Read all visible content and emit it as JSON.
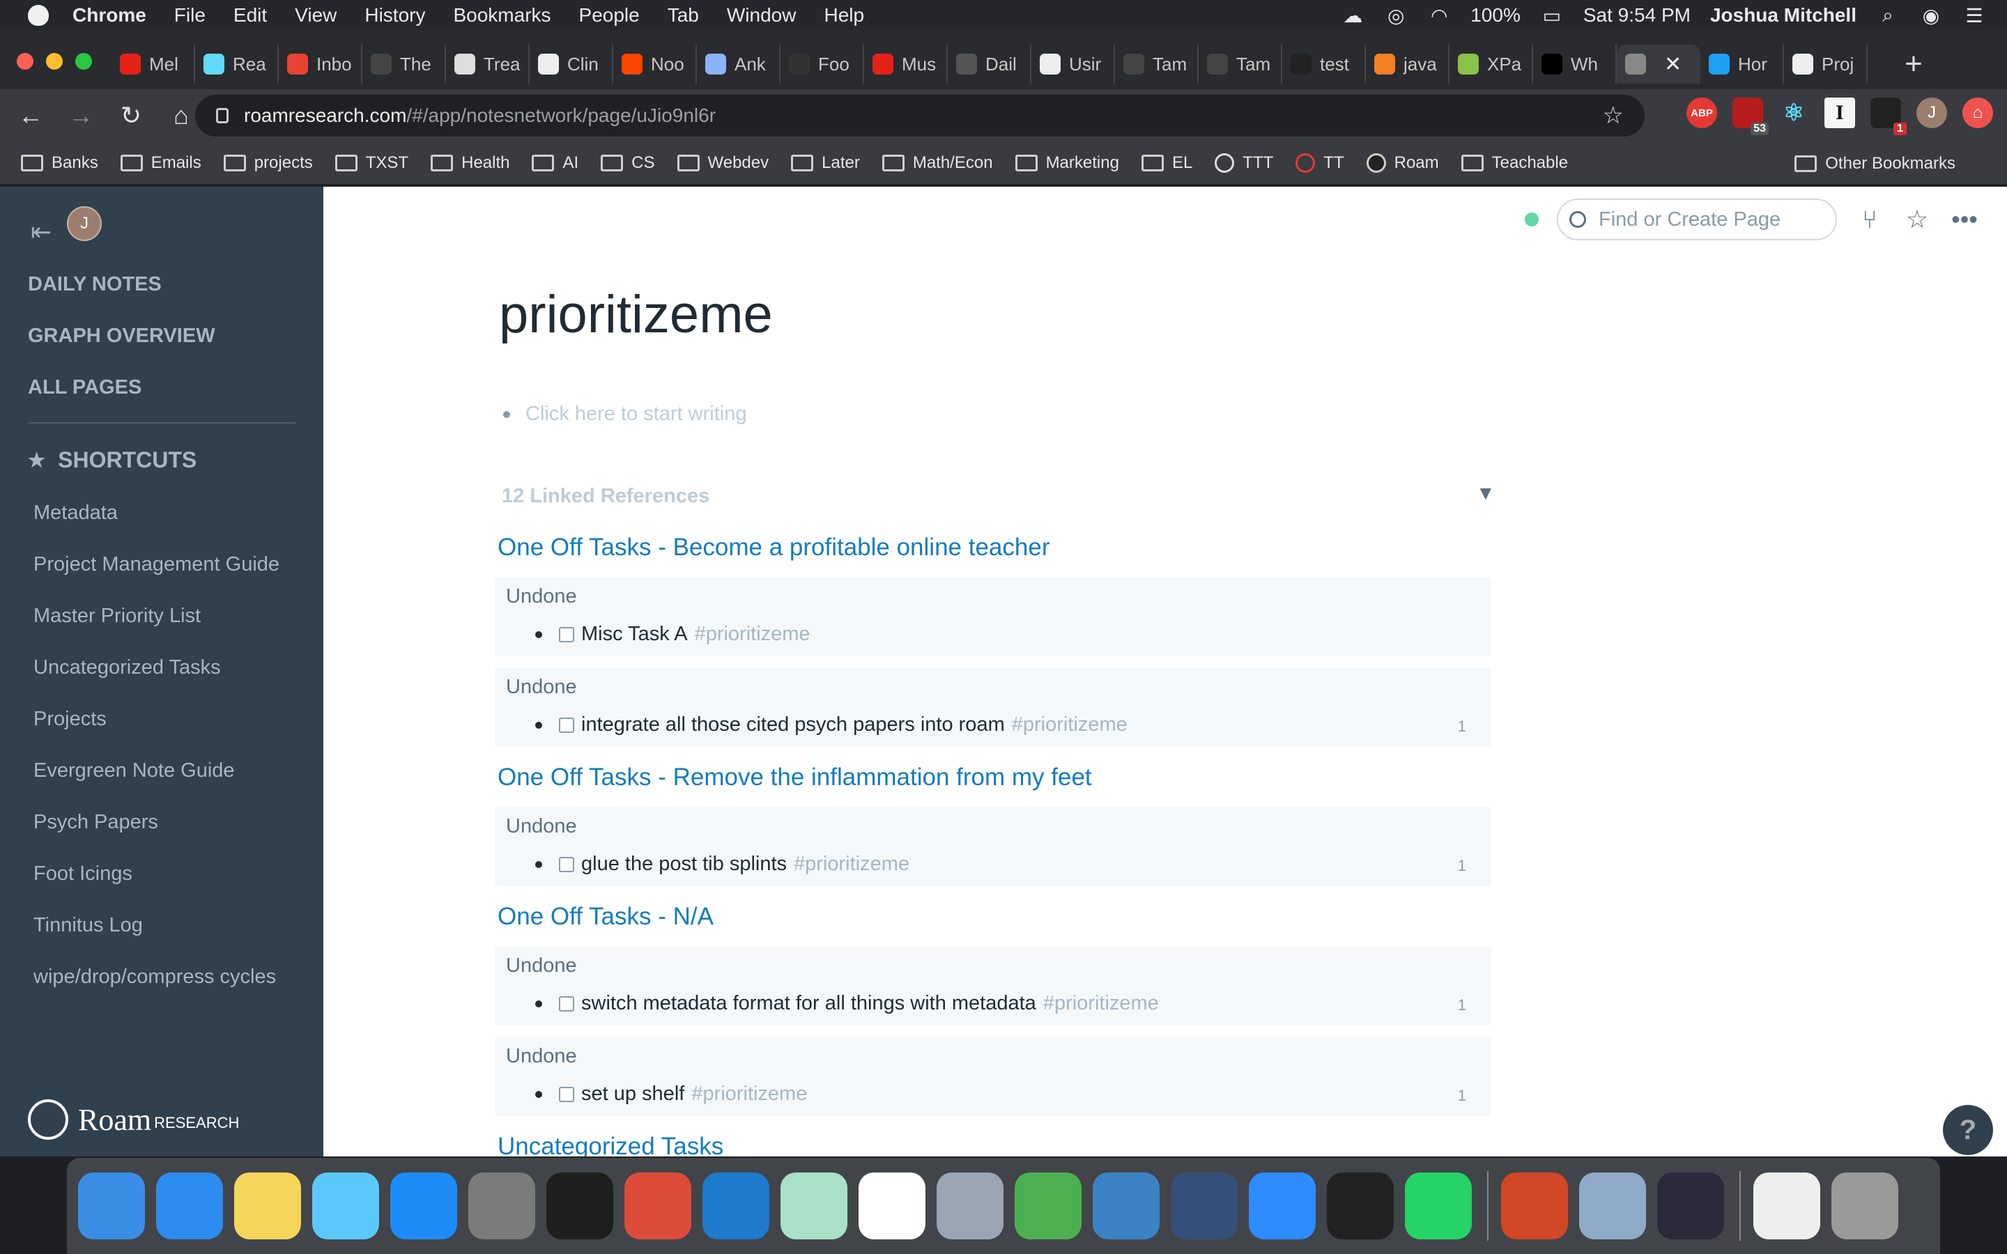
{
  "menubar": {
    "items": [
      "Chrome",
      "File",
      "Edit",
      "View",
      "History",
      "Bookmarks",
      "People",
      "Tab",
      "Window",
      "Help"
    ],
    "battery": "100%",
    "datetime": "Sat 9:54 PM",
    "user": "Joshua Mitchell"
  },
  "tabs": [
    {
      "label": "Mel",
      "color": "#e62117"
    },
    {
      "label": "Rea",
      "color": "#61dafb"
    },
    {
      "label": "Inbo",
      "color": "#ea4335"
    },
    {
      "label": "The",
      "color": "#444444"
    },
    {
      "label": "Trea",
      "color": "#dddddd"
    },
    {
      "label": "Clin",
      "color": "#eeeeee"
    },
    {
      "label": "Noo",
      "color": "#ff4500"
    },
    {
      "label": "Ank",
      "color": "#8ab4f8"
    },
    {
      "label": "Foo",
      "color": "#333333"
    },
    {
      "label": "Mus",
      "color": "#e62117"
    },
    {
      "label": "Dail",
      "color": "#555555"
    },
    {
      "label": "Usir",
      "color": "#eeeeee"
    },
    {
      "label": "Tam",
      "color": "#444444"
    },
    {
      "label": "Tam",
      "color": "#444444"
    },
    {
      "label": "test",
      "color": "#222222"
    },
    {
      "label": "java",
      "color": "#f48024"
    },
    {
      "label": "XPa",
      "color": "#8bc34a"
    },
    {
      "label": "Wh",
      "color": "#000000"
    },
    {
      "label": "",
      "color": "#888888",
      "active": true
    },
    {
      "label": "Hor",
      "color": "#1da1f2"
    },
    {
      "label": "Proj",
      "color": "#eeeeee"
    }
  ],
  "address": {
    "host": "roamresearch.com",
    "path": "/#/app/notesnetwork/page/uJio9nl6r"
  },
  "extensions": {
    "abp": "ABP",
    "ud_badge": "53",
    "ublock_badge": "1",
    "profile_initial": "J"
  },
  "bookmarks": [
    "Banks",
    "Emails",
    "projects",
    "TXST",
    "Health",
    "AI",
    "CS",
    "Webdev",
    "Later",
    "Math/Econ",
    "Marketing",
    "EL",
    "TTT",
    "TT",
    "Roam",
    "Teachable"
  ],
  "bookmarks_other": "Other Bookmarks",
  "sidebar": {
    "avatar_initial": "J",
    "daily_notes": "DAILY NOTES",
    "graph_overview": "GRAPH OVERVIEW",
    "all_pages": "ALL PAGES",
    "shortcuts_title": "SHORTCUTS",
    "shortcuts": [
      "Metadata",
      "Project Management Guide",
      "Master Priority List",
      "Uncategorized Tasks",
      "Projects",
      "Evergreen Note Guide",
      "Psych Papers",
      "Foot Icings",
      "Tinnitus Log",
      "wipe/drop/compress cycles"
    ],
    "logo_word": "Roam",
    "logo_sub": "RESEARCH"
  },
  "search": {
    "placeholder": "Find or Create Page"
  },
  "page": {
    "title": "prioritizeme",
    "empty_block": "Click here to start writing",
    "linked_refs_label": "12 Linked References"
  },
  "references": [
    {
      "title": "One Off Tasks - Become a profitable online teacher",
      "blocks": [
        {
          "group": "Undone",
          "text": "Misc Task A",
          "tag": "#prioritizeme",
          "count": ""
        },
        {
          "group": "Undone",
          "text": "integrate all those cited psych papers into roam",
          "tag": "#prioritizeme",
          "count": "1"
        }
      ]
    },
    {
      "title": "One Off Tasks - Remove the inflammation from my feet",
      "blocks": [
        {
          "group": "Undone",
          "text": "glue the post tib splints",
          "tag": "#prioritizeme",
          "count": "1"
        }
      ]
    },
    {
      "title": "One Off Tasks - N/A",
      "blocks": [
        {
          "group": "Undone",
          "text": "switch metadata format for all things with metadata",
          "tag": "#prioritizeme",
          "count": "1"
        },
        {
          "group": "Undone",
          "text": "set up shelf",
          "tag": "#prioritizeme",
          "count": "1"
        }
      ]
    },
    {
      "title": "Uncategorized Tasks",
      "blocks": []
    }
  ],
  "help_button": "?",
  "dock": [
    {
      "name": "finder",
      "color": "#3a8ee6"
    },
    {
      "name": "safari",
      "color": "#2c8cf0"
    },
    {
      "name": "notes",
      "color": "#f6d65a"
    },
    {
      "name": "messages",
      "color": "#5ac8fa"
    },
    {
      "name": "app-store",
      "color": "#1d8cf8"
    },
    {
      "name": "system-preferences",
      "color": "#7b7b7b"
    },
    {
      "name": "terminal",
      "color": "#1e1e1e"
    },
    {
      "name": "chrome",
      "color": "#dd4b39"
    },
    {
      "name": "vscode",
      "color": "#1e7acc"
    },
    {
      "name": "keyboard-app",
      "color": "#a8e0c8"
    },
    {
      "name": "slack",
      "color": "#ffffff"
    },
    {
      "name": "xcode-instruments",
      "color": "#9aa5b4"
    },
    {
      "name": "camtasia",
      "color": "#4caf50"
    },
    {
      "name": "sublime-scrivener",
      "color": "#3b82c4"
    },
    {
      "name": "screen-app",
      "color": "#34507a"
    },
    {
      "name": "zoom",
      "color": "#2d8cff"
    },
    {
      "name": "obs",
      "color": "#222222"
    },
    {
      "name": "whatsapp",
      "color": "#25d366"
    },
    {
      "name": "powerpoint",
      "color": "#d24726"
    },
    {
      "name": "preview",
      "color": "#8fa9c9"
    },
    {
      "name": "screen-recorder",
      "color": "#2a2a3a"
    },
    {
      "name": "document",
      "color": "#eeeeee"
    },
    {
      "name": "trash",
      "color": "#9a9a9a"
    }
  ]
}
